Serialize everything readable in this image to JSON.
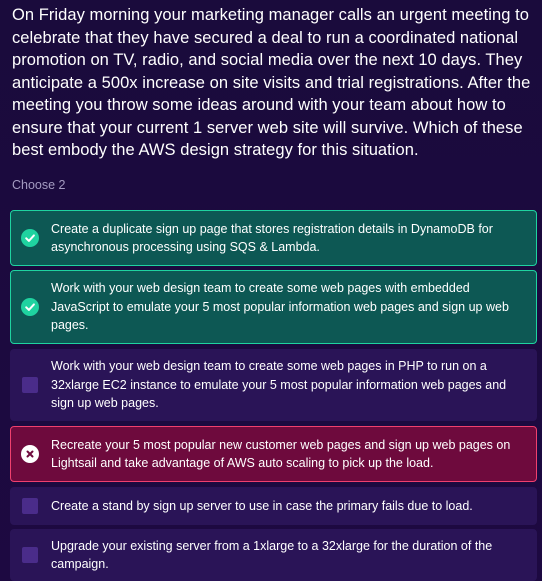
{
  "question": {
    "text": "On Friday morning your marketing manager calls an urgent meeting to celebrate that they have secured a deal to run a coordinated national promotion on TV, radio, and social media over the next 10 days. They anticipate a 500x increase on site visits and trial registrations. After the meeting you throw some ideas around with your team about how to ensure that your current 1 server web site will survive. Which of these best embody the AWS design strategy for this situation."
  },
  "instruction": "Choose 2",
  "colors": {
    "correct_bg": "#0d5854",
    "correct_border": "#1fd3a0",
    "incorrect_bg": "#6e0a3d",
    "incorrect_border": "#f0406e",
    "neutral_bg": "#2a1457"
  },
  "options": [
    {
      "text": "Create a duplicate sign up page that stores registration details in DynamoDB for asynchronous processing using SQS & Lambda.",
      "state": "correct",
      "icon": "check-circle-icon"
    },
    {
      "text": "Work with your web design team to create some web pages with embedded JavaScript to emulate your 5 most popular information web pages and sign up web pages.",
      "state": "correct",
      "icon": "check-circle-icon"
    },
    {
      "text": "Work with your web design team to create some web pages in PHP to run on a 32xlarge EC2 instance to emulate your 5 most popular information web pages and sign up web pages.",
      "state": "unselected",
      "icon": "checkbox-icon"
    },
    {
      "text": "Recreate your 5 most popular new customer web pages and sign up web pages on Lightsail and take advantage of AWS auto scaling to pick up the load.",
      "state": "incorrect",
      "icon": "cross-circle-icon"
    },
    {
      "text": "Create a stand by sign up server to use in case the primary fails due to load.",
      "state": "unselected",
      "icon": "checkbox-icon"
    },
    {
      "text": "Upgrade your existing server from a 1xlarge to a 32xlarge for the duration of the campaign.",
      "state": "unselected",
      "icon": "checkbox-icon"
    }
  ]
}
